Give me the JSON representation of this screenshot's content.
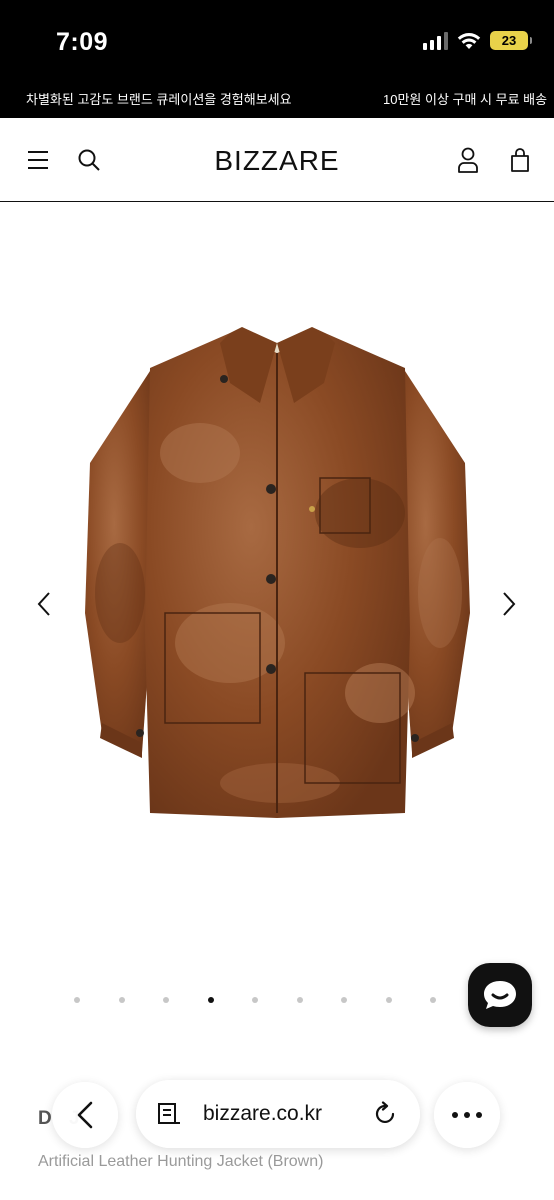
{
  "status_bar": {
    "time": "7:09",
    "battery": "23",
    "icons": [
      "cellular-signal-icon",
      "wifi-icon",
      "battery-charging-icon"
    ]
  },
  "promo": {
    "left_text": "차별화된 고감도 브랜드 큐레이션을 경험해보세요",
    "right_text": "10만원 이상 구매 시 무료 배송"
  },
  "header": {
    "logo": "BIZZARE",
    "icons": [
      "hamburger-menu-icon",
      "search-icon",
      "user-icon",
      "shopping-bag-icon"
    ]
  },
  "gallery": {
    "image_label": "brown artificial leather hunting jacket",
    "slide_count": 9,
    "active_slide": 4,
    "icons": [
      "chevron-left-icon",
      "chevron-right-icon"
    ]
  },
  "product": {
    "brand": "D  J",
    "name": "Artificial Leather Hunting Jacket (Brown)"
  },
  "browser": {
    "url": "bizzare.co.kr",
    "icons": [
      "back-arrow-icon",
      "reader-mode-icon",
      "reload-icon",
      "more-options-icon"
    ]
  },
  "colors": {
    "banner_bg": "#000000",
    "text": "#111111",
    "muted_text": "#9a9a9a",
    "dot_inactive": "#c7c7c7",
    "battery": "#e8d24a",
    "jacket_brown": "#8a4a24"
  }
}
